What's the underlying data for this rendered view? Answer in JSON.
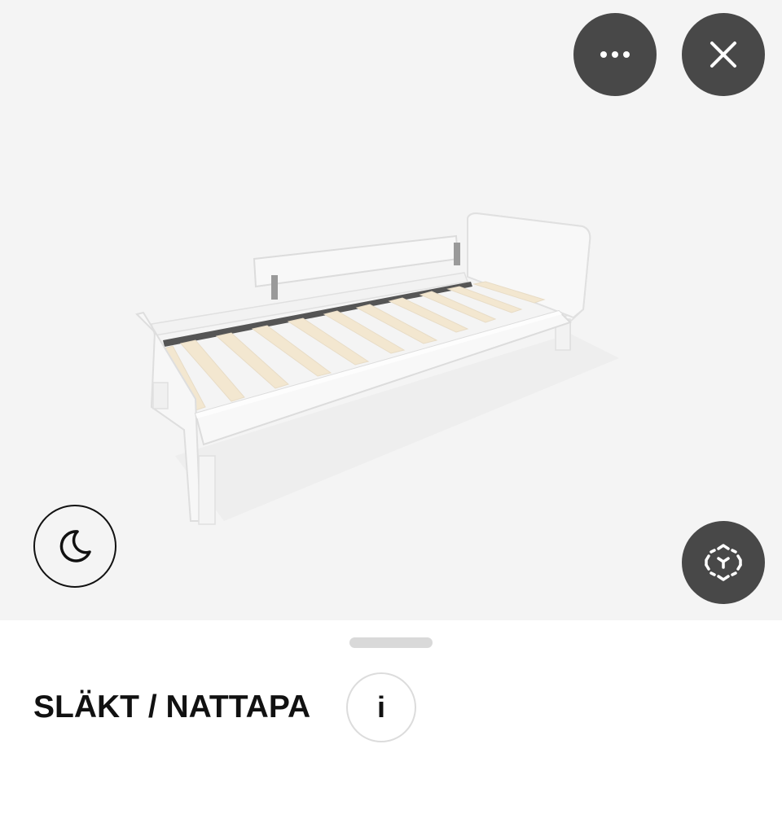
{
  "viewer": {
    "model_description_icon": "bed-3d-model",
    "toolbar": {
      "more_icon": "more-horizontal-icon",
      "close_icon": "close-icon"
    },
    "night_mode_icon": "moon-icon",
    "ar_view_icon": "ar-cube-icon"
  },
  "sheet": {
    "product_title": "SLÄKT / NATTAPA",
    "info_label": "i"
  },
  "colors": {
    "viewer_background": "#f4f4f4",
    "button_dark": "#484848",
    "text": "#111111"
  }
}
